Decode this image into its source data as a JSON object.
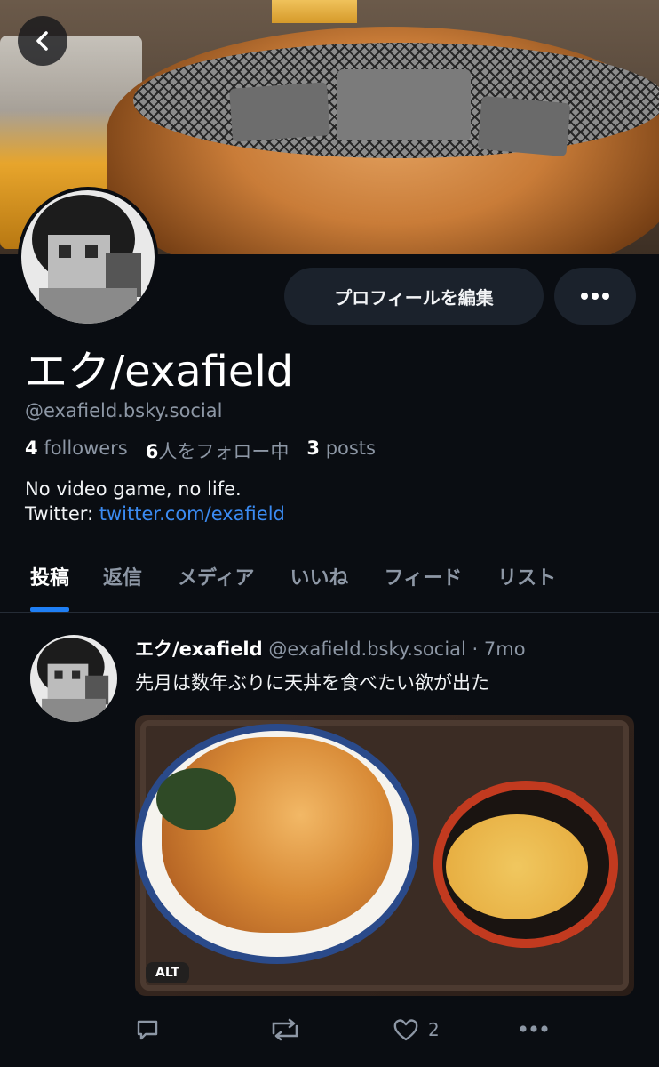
{
  "profile": {
    "display_name": "エク/exafield",
    "handle": "@exafield.bsky.social",
    "followers_count": "4",
    "followers_label": "followers",
    "following_count": "6",
    "following_label": "人をフォロー中",
    "posts_count": "3",
    "posts_label": "posts",
    "bio_line1": "No video game, no life.",
    "bio_line2_prefix": "Twitter: ",
    "bio_link": "twitter.com/exafield"
  },
  "actions": {
    "edit_profile": "プロフィールを編集"
  },
  "tabs": [
    {
      "label": "投稿",
      "active": true
    },
    {
      "label": "返信",
      "active": false
    },
    {
      "label": "メディア",
      "active": false
    },
    {
      "label": "いいね",
      "active": false
    },
    {
      "label": "フィード",
      "active": false
    },
    {
      "label": "リスト",
      "active": false
    }
  ],
  "post": {
    "author_name": "エク/exafield",
    "author_handle": "@exafield.bsky.social",
    "separator": " · ",
    "age": "7mo",
    "text": "先月は数年ぶりに天丼を食べたい欲が出た",
    "alt_badge": "ALT",
    "like_count": "2"
  },
  "colors": {
    "background": "#0a0d12",
    "accent": "#1f7ff5",
    "link": "#3b8bf2",
    "muted": "#8d97a5"
  },
  "icons": [
    "back-arrow-icon",
    "more-dots-icon",
    "reply-icon",
    "repost-icon",
    "like-heart-icon",
    "more-horizontal-icon"
  ]
}
